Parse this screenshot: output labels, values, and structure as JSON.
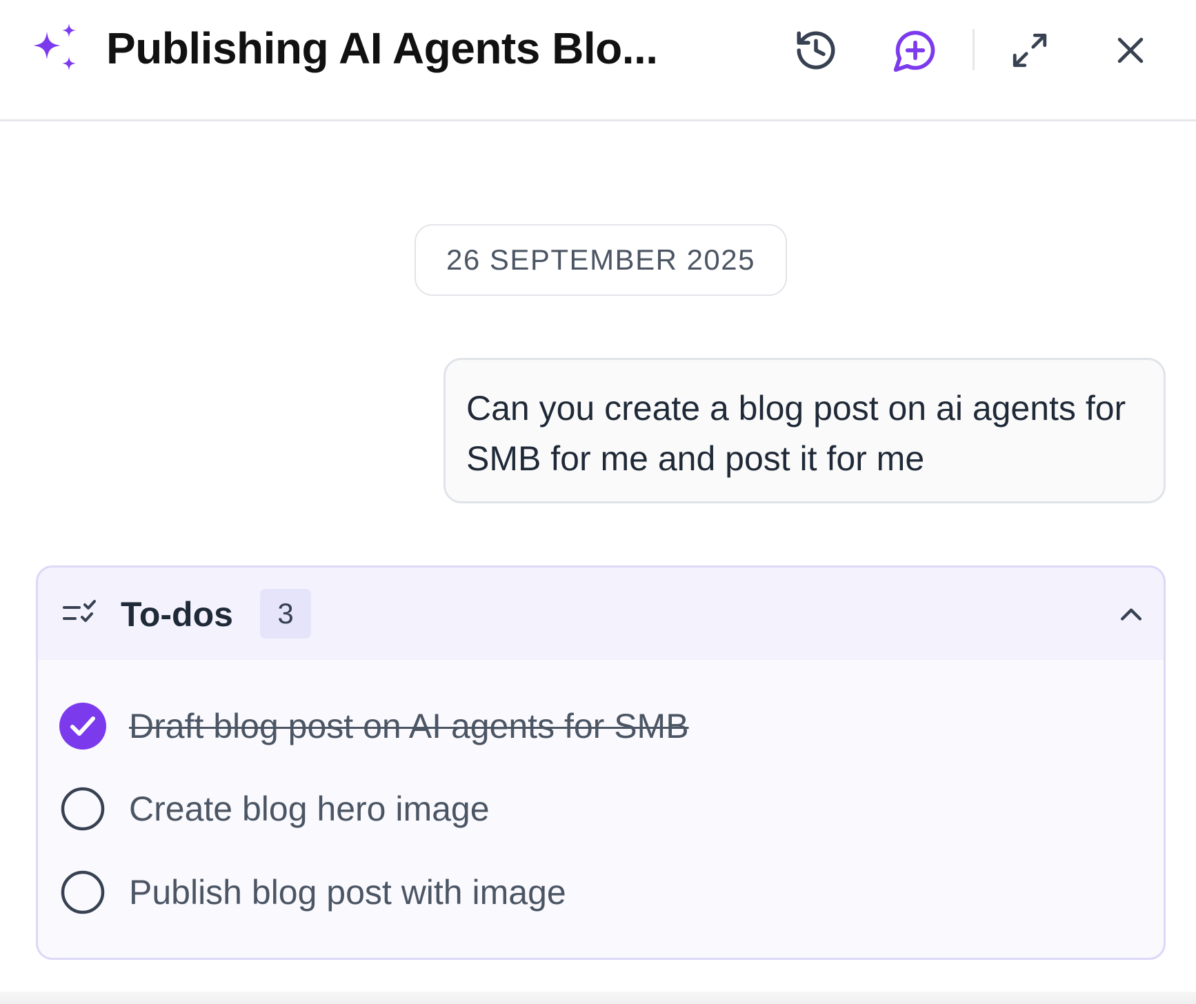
{
  "header": {
    "title": "Publishing AI Agents Blo...",
    "icons": {
      "logo": "sparkle-icon",
      "history": "history-icon",
      "new_chat": "new-chat-icon",
      "expand": "expand-icon",
      "close": "close-icon"
    }
  },
  "conversation": {
    "date_label": "26 SEPTEMBER 2025",
    "user_message": "Can you create a blog post on ai agents for SMB for me and post it for me"
  },
  "todos": {
    "title": "To-dos",
    "count": "3",
    "items": [
      {
        "label": "Draft blog post on AI agents for SMB",
        "done": true
      },
      {
        "label": "Create blog hero image",
        "done": false
      },
      {
        "label": "Publish blog post with image",
        "done": false
      }
    ]
  },
  "colors": {
    "accent": "#7c3aed",
    "todos_border": "#dcd8f7",
    "todos_header_bg": "#f3f2fd",
    "todos_body_bg": "#f9f9fe"
  }
}
